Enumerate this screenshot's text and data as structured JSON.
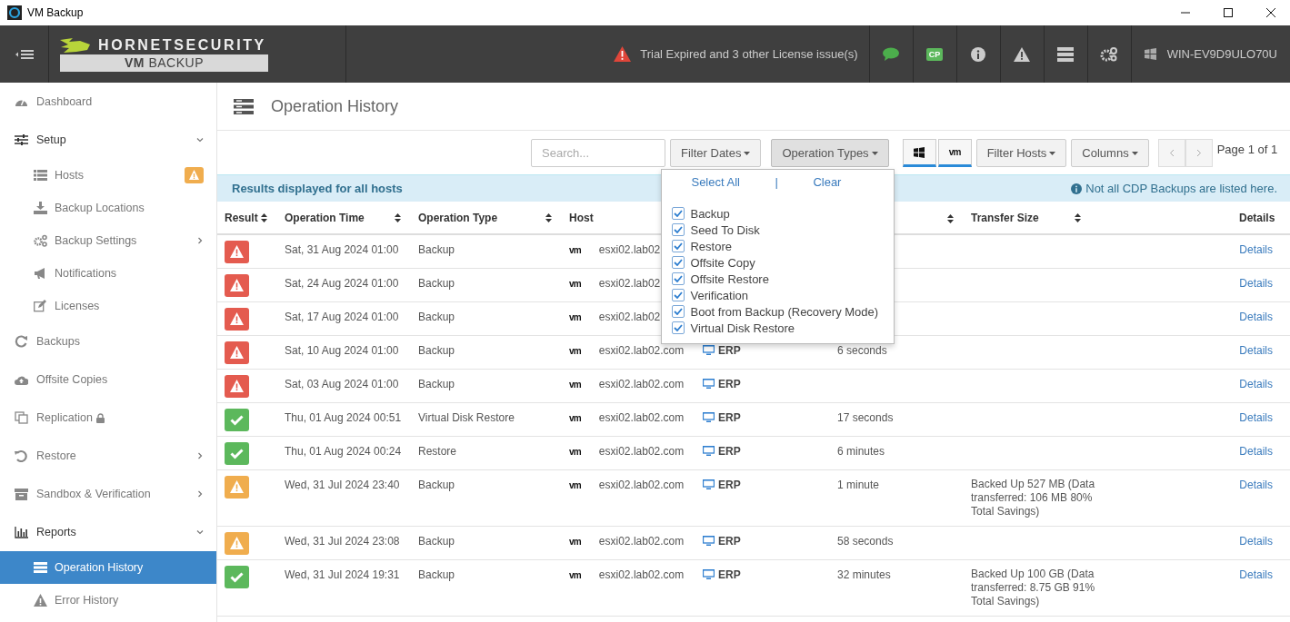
{
  "window": {
    "title": "VM Backup"
  },
  "header": {
    "logo": {
      "brand": "HORNETSECURITY",
      "product": "**VM** BACKUP"
    },
    "license_alert": "Trial Expired and 3 other License issue(s)",
    "cp_badge": "CP",
    "host": "WIN-EV9D9ULO70U"
  },
  "sidebar": {
    "items": [
      {
        "label": "Dashboard"
      },
      {
        "label": "Setup",
        "expanded": true,
        "children": [
          {
            "label": "Hosts",
            "alert": true
          },
          {
            "label": "Backup Locations"
          },
          {
            "label": "Backup Settings",
            "expanded": false
          },
          {
            "label": "Notifications"
          },
          {
            "label": "Licenses"
          }
        ]
      },
      {
        "label": "Backups"
      },
      {
        "label": "Offsite Copies"
      },
      {
        "label": "Replication",
        "locked": true
      },
      {
        "label": "Restore",
        "expanded": false
      },
      {
        "label": "Sandbox & Verification",
        "expanded": false
      },
      {
        "label": "Reports",
        "expanded": true,
        "children": [
          {
            "label": "Operation History",
            "selected": true
          },
          {
            "label": "Error History",
            "selected": false
          }
        ]
      }
    ]
  },
  "page": {
    "title": "Operation History"
  },
  "toolbar": {
    "search": {
      "placeholder": "Search..."
    },
    "filter_dates": "Filter Dates",
    "operation_types": "Operation Types",
    "platforms": [
      {
        "kind": "windows",
        "selected": true
      },
      {
        "kind": "vm",
        "label": "vm",
        "selected": true
      }
    ],
    "filter_hosts": "Filter Hosts",
    "columns": "Columns",
    "pager": "Page 1 of 1"
  },
  "banner": {
    "text": "Results displayed for all hosts",
    "note": "Not all CDP Backups are listed here."
  },
  "operation_types_menu": {
    "select_all": "Select All",
    "separator": "|",
    "clear": "Clear",
    "options": [
      {
        "label": "Backup",
        "checked": true
      },
      {
        "label": "Seed To Disk",
        "checked": true
      },
      {
        "label": "Restore",
        "checked": true
      },
      {
        "label": "Offsite Copy",
        "checked": true
      },
      {
        "label": "Offsite Restore",
        "checked": true
      },
      {
        "label": "Verification",
        "checked": true
      },
      {
        "label": "Boot from Backup (Recovery Mode)",
        "checked": true
      },
      {
        "label": "Virtual Disk Restore",
        "checked": true
      }
    ]
  },
  "table": {
    "columns": [
      "Result",
      "Operation Time",
      "Operation Type",
      "Host",
      "Transfer Size",
      "Details"
    ],
    "rows": [
      {
        "kind": "error",
        "time": "Sat, 31 Aug 2024 01:00",
        "type": "Backup",
        "platform": "vm",
        "host": "esxi02.lab02",
        "details": "Details"
      },
      {
        "kind": "error",
        "time": "Sat, 24 Aug 2024 01:00",
        "type": "Backup",
        "platform": "vm",
        "host": "esxi02.lab02",
        "details": "Details"
      },
      {
        "kind": "error",
        "time": "Sat, 17 Aug 2024 01:00",
        "type": "Backup",
        "platform": "vm",
        "host": "esxi02.lab02",
        "details": "Details"
      },
      {
        "kind": "error",
        "time": "Sat, 10 Aug 2024 01:00",
        "type": "Backup",
        "platform": "vm",
        "host": "esxi02.lab02.com",
        "vm": "ERP",
        "duration": "6 seconds",
        "details": "Details"
      },
      {
        "kind": "error",
        "time": "Sat, 03 Aug 2024 01:00",
        "type": "Backup",
        "platform": "vm",
        "host": "esxi02.lab02.com",
        "vm": "ERP",
        "details": "Details"
      },
      {
        "kind": "success",
        "time": "Thu, 01 Aug 2024 00:51",
        "type": "Virtual Disk Restore",
        "platform": "vm",
        "host": "esxi02.lab02.com",
        "vm": "ERP",
        "duration": "17 seconds",
        "details": "Details"
      },
      {
        "kind": "success",
        "time": "Thu, 01 Aug 2024 00:24",
        "type": "Restore",
        "platform": "vm",
        "host": "esxi02.lab02.com",
        "vm": "ERP",
        "duration": "6 minutes",
        "details": "Details"
      },
      {
        "kind": "warning",
        "time": "Wed, 31 Jul 2024 23:40",
        "type": "Backup",
        "platform": "vm",
        "host": "esxi02.lab02.com",
        "vm": "ERP",
        "duration": "1 minute",
        "transfer": "Backed Up 527 MB (Data transferred: 106 MB 80% Total Savings)",
        "details": "Details"
      },
      {
        "kind": "warning",
        "time": "Wed, 31 Jul 2024 23:08",
        "type": "Backup",
        "platform": "vm",
        "host": "esxi02.lab02.com",
        "vm": "ERP",
        "duration": "58 seconds",
        "details": "Details"
      },
      {
        "kind": "success",
        "time": "Wed, 31 Jul 2024 19:31",
        "type": "Backup",
        "platform": "vm",
        "host": "esxi02.lab02.com",
        "vm": "ERP",
        "duration": "32 minutes",
        "transfer": "Backed Up 100 GB (Data transferred: 8.75 GB 91% Total Savings)",
        "details": "Details"
      }
    ]
  }
}
